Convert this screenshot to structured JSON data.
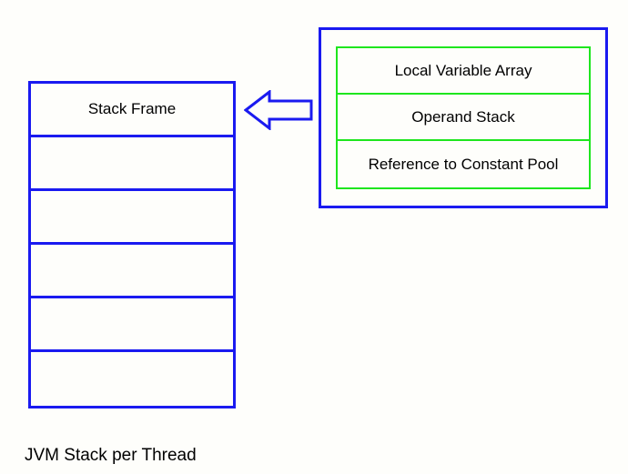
{
  "stack": {
    "rows": [
      "Stack Frame",
      "",
      "",
      "",
      "",
      ""
    ],
    "caption": "JVM Stack per Thread"
  },
  "frame_detail": {
    "rows": [
      "Local Variable Array",
      "Operand Stack",
      "Reference to Constant Pool"
    ]
  }
}
